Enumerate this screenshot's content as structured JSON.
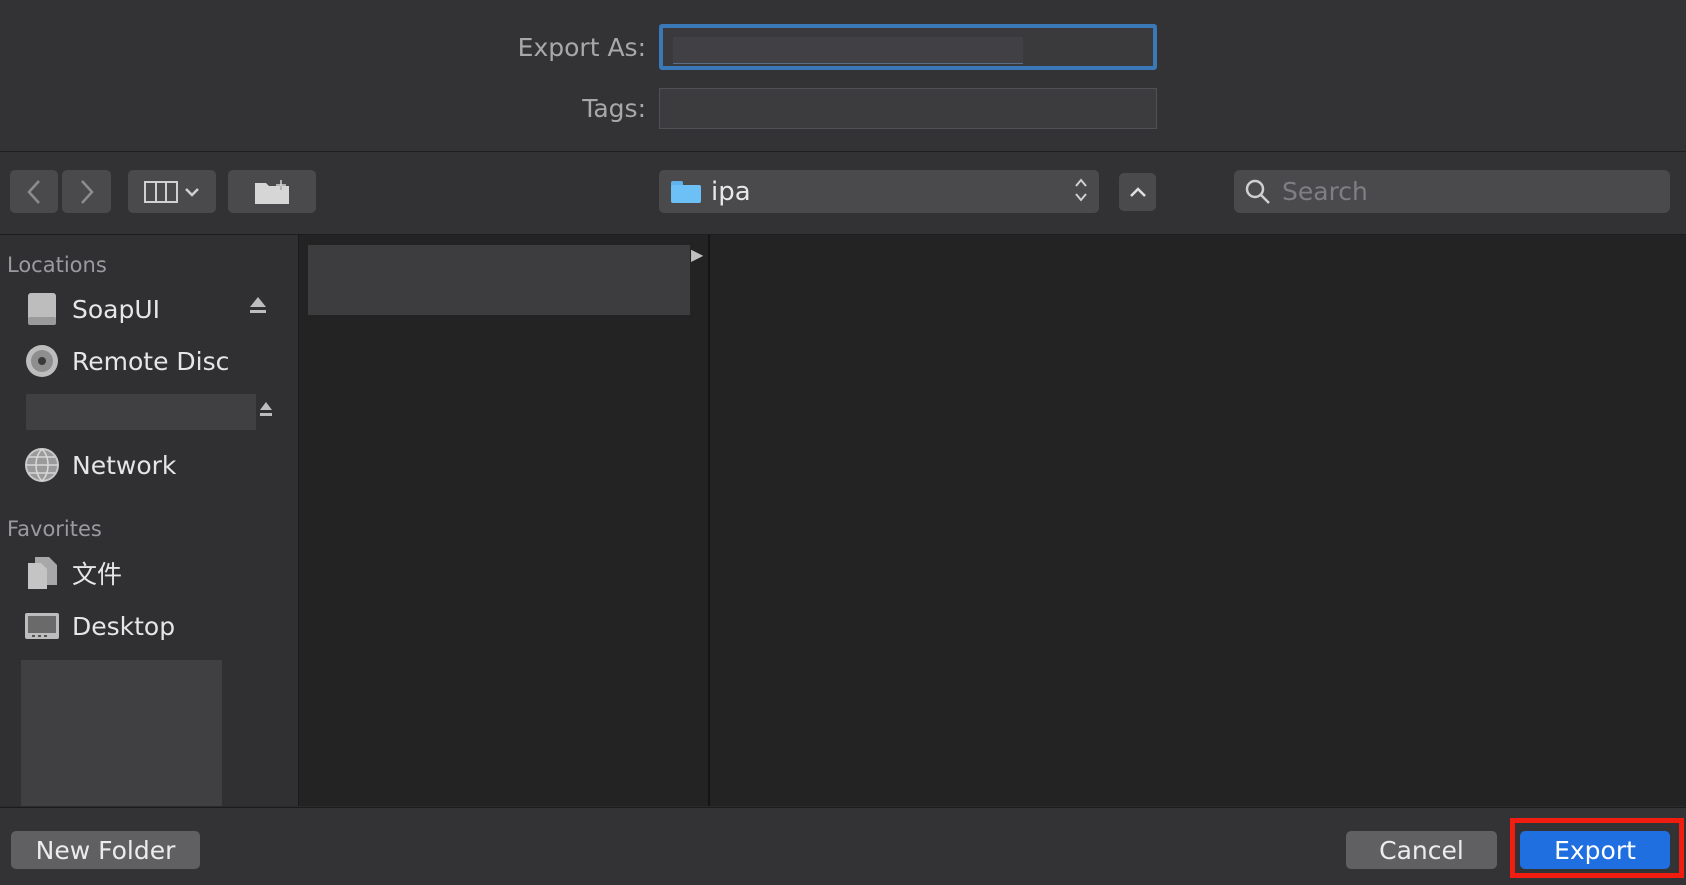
{
  "form": {
    "export_as_label": "Export As:",
    "export_as_value": "",
    "tags_label": "Tags:",
    "tags_value": ""
  },
  "toolbar": {
    "back_icon": "chevron-left-icon",
    "forward_icon": "chevron-right-icon",
    "view_icon": "columns-view-icon",
    "new_folder_icon": "folder-plus-icon",
    "location": "ipa",
    "location_icon": "folder-icon",
    "collapse_icon": "chevron-up-icon",
    "search_placeholder": "Search"
  },
  "sidebar": {
    "locations_heading": "Locations",
    "locations": [
      {
        "label": "SoapUI",
        "icon": "disk-icon",
        "ejectable": true
      },
      {
        "label": "Remote Disc",
        "icon": "disc-icon",
        "ejectable": false
      },
      {
        "label": "",
        "icon": "",
        "ejectable": true
      },
      {
        "label": "Network",
        "icon": "globe-icon",
        "ejectable": false
      }
    ],
    "favorites_heading": "Favorites",
    "favorites": [
      {
        "label": "文件",
        "icon": "documents-icon"
      },
      {
        "label": "Desktop",
        "icon": "desktop-icon"
      }
    ]
  },
  "buttons": {
    "new_folder": "New Folder",
    "cancel": "Cancel",
    "export": "Export"
  },
  "colors": {
    "accent": "#1f6fe0",
    "focus_ring": "#3b78b8",
    "highlight": "#f01d10",
    "folder": "#6cc0f5"
  }
}
